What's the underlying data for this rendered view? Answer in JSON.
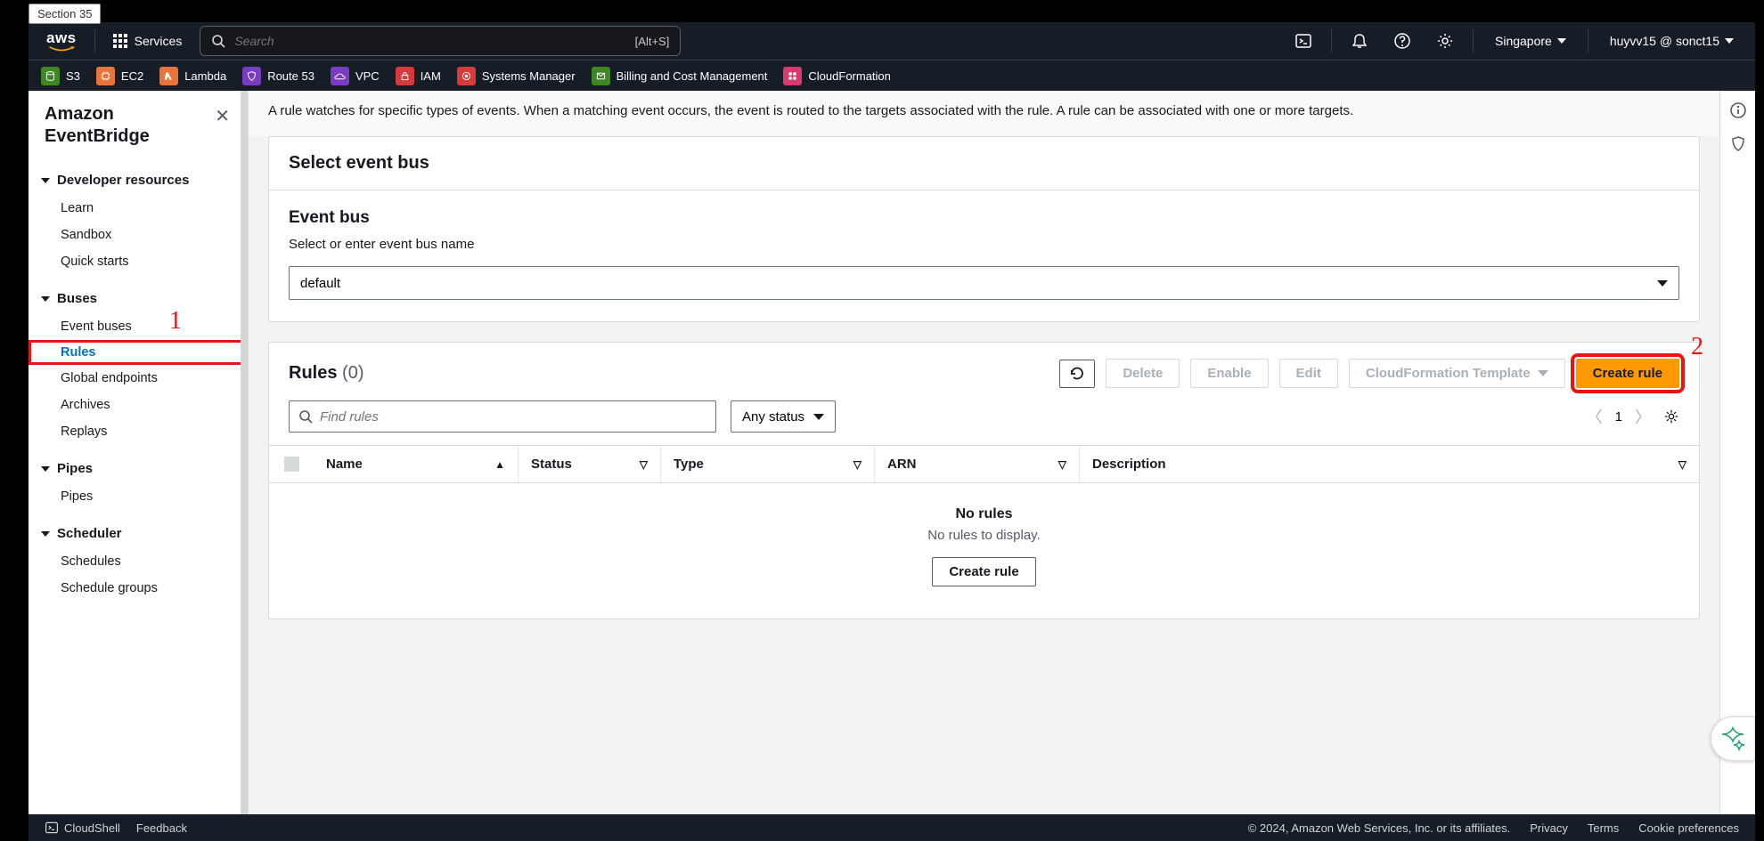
{
  "section_tag": "Section 35",
  "topnav": {
    "services_label": "Services",
    "search_placeholder": "Search",
    "search_shortcut": "[Alt+S]",
    "region": "Singapore",
    "user": "huyvv15 @ sonct15"
  },
  "svc_shortcuts": [
    {
      "label": "S3",
      "color": "#3f8624"
    },
    {
      "label": "EC2",
      "color": "#e7743c"
    },
    {
      "label": "Lambda",
      "color": "#e7743c"
    },
    {
      "label": "Route 53",
      "color": "#7a3cc1"
    },
    {
      "label": "VPC",
      "color": "#7a3cc1"
    },
    {
      "label": "IAM",
      "color": "#d63b3b"
    },
    {
      "label": "Systems Manager",
      "color": "#d63b3b"
    },
    {
      "label": "Billing and Cost Management",
      "color": "#3f8624"
    },
    {
      "label": "CloudFormation",
      "color": "#d63b6e"
    }
  ],
  "sidebar": {
    "title": "Amazon EventBridge",
    "sections": [
      {
        "title": "Developer resources",
        "items": [
          "Learn",
          "Sandbox",
          "Quick starts"
        ]
      },
      {
        "title": "Buses",
        "items": [
          "Event buses",
          "Rules",
          "Global endpoints",
          "Archives",
          "Replays"
        ]
      },
      {
        "title": "Pipes",
        "items": [
          "Pipes"
        ]
      },
      {
        "title": "Scheduler",
        "items": [
          "Schedules",
          "Schedule groups"
        ]
      }
    ]
  },
  "annotations": {
    "one": "1",
    "two": "2"
  },
  "content": {
    "desc": "A rule watches for specific types of events. When a matching event occurs, the event is routed to the targets associated with the rule. A rule can be associated with one or more targets.",
    "select_bus_title": "Select event bus",
    "event_bus_label": "Event bus",
    "event_bus_hint": "Select or enter event bus name",
    "event_bus_value": "default",
    "rules_title": "Rules",
    "rules_count": "(0)",
    "btn_delete": "Delete",
    "btn_enable": "Enable",
    "btn_edit": "Edit",
    "btn_cf_template": "CloudFormation Template",
    "btn_create": "Create rule",
    "find_placeholder": "Find rules",
    "status_filter": "Any status",
    "page_number": "1",
    "cols": {
      "name": "Name",
      "status": "Status",
      "type": "Type",
      "arn": "ARN",
      "desc": "Description"
    },
    "empty_head": "No rules",
    "empty_sub": "No rules to display.",
    "empty_btn": "Create rule"
  },
  "footer": {
    "cloudshell": "CloudShell",
    "feedback": "Feedback",
    "copyright": "© 2024, Amazon Web Services, Inc. or its affiliates.",
    "privacy": "Privacy",
    "terms": "Terms",
    "cookies": "Cookie preferences"
  }
}
